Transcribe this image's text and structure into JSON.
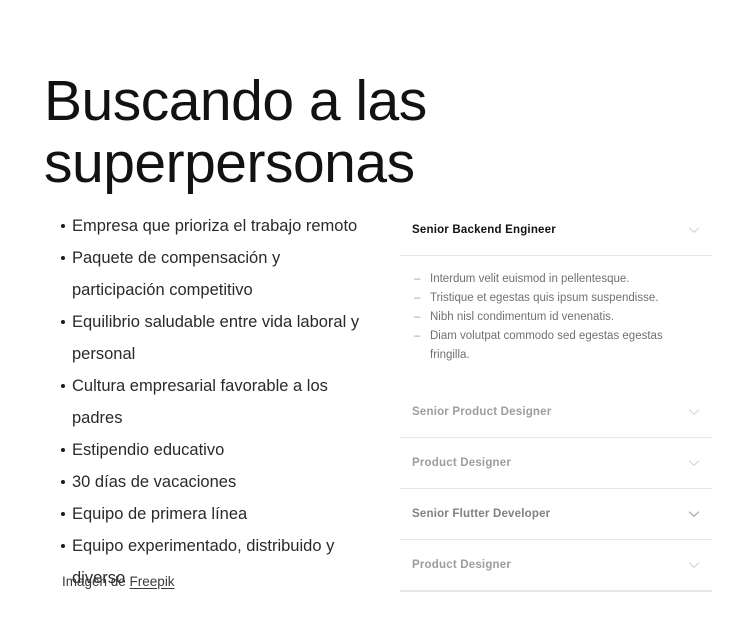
{
  "page": {
    "background_color": "#ffffff",
    "text_color": "#1c1c1c"
  },
  "hero": {
    "heading": "Buscando a las\nsuperpersonas"
  },
  "benefits": {
    "items": [
      "Empresa que prioriza el trabajo remoto",
      "Paquete de compensación y participación competitivo",
      "Equilibrio saludable entre vida laboral y personal",
      "Cultura empresarial favorable a los padres",
      "Estipendio educativo",
      "30 días de vacaciones",
      "Equipo de primera línea",
      "Equipo experimentado, distribuido y diverso"
    ]
  },
  "credit": {
    "prefix": "Imagen de ",
    "link_label": "Freepik"
  },
  "accordion": {
    "chevron_icon": "chevron-down-icon",
    "divider_color": "#e6e7e9",
    "items": [
      {
        "title": "Senior Backend Engineer",
        "state": "open",
        "title_color": "#121212",
        "chevron_color": "#d2d4d7",
        "body": [
          "Interdum velit euismod in pellentesque.",
          "Tristique et egestas quis ipsum suspendisse.",
          "Nibh nisl condimentum id venenatis.",
          "Diam volutpat commodo sed egestas egestas fringilla."
        ]
      },
      {
        "title": "Senior Product Designer",
        "state": "collapsed",
        "title_color": "#9a9da1",
        "chevron_color": "#d2d4d7",
        "body": []
      },
      {
        "title": "Product Designer",
        "state": "collapsed",
        "title_color": "#9a9da1",
        "chevron_color": "#d2d4d7",
        "body": []
      },
      {
        "title": "Senior Flutter Developer",
        "state": "collapsed-emphasis",
        "title_color": "#7e8186",
        "chevron_color": "#9ea1a5",
        "body": []
      },
      {
        "title": "Product Designer",
        "state": "collapsed",
        "title_color": "#9a9da1",
        "chevron_color": "#d2d4d7",
        "body": []
      }
    ]
  }
}
